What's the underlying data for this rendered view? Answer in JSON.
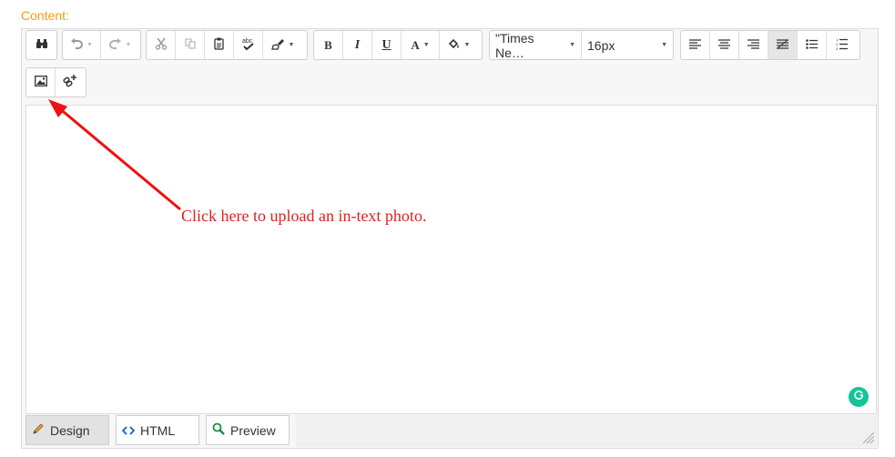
{
  "field": {
    "label": "Content:"
  },
  "toolbar": {
    "font_family": "\"Times Ne…",
    "font_size": "16px",
    "bold": "B",
    "italic": "I",
    "underline": "U",
    "font_color": "A"
  },
  "note": {
    "text": "Click here to upload an in-text photo."
  },
  "tabs": {
    "design": "Design",
    "html": "HTML",
    "preview": "Preview"
  },
  "colors": {
    "label": "#f39c12",
    "note": "#e02020",
    "grammarly": "#15c39a"
  },
  "icons": [
    "find-icon",
    "undo-icon",
    "redo-icon",
    "cut-icon",
    "copy-icon",
    "paste-icon",
    "spellcheck-icon",
    "format-painter-icon",
    "background-color-icon",
    "align-left-icon",
    "align-center-icon",
    "align-right-icon",
    "justify-icon",
    "bullet-list-icon",
    "numbered-list-icon",
    "insert-image-icon",
    "insert-link-icon",
    "grammarly-icon",
    "pencil-icon",
    "code-icon",
    "preview-icon",
    "resize-handle-icon"
  ]
}
